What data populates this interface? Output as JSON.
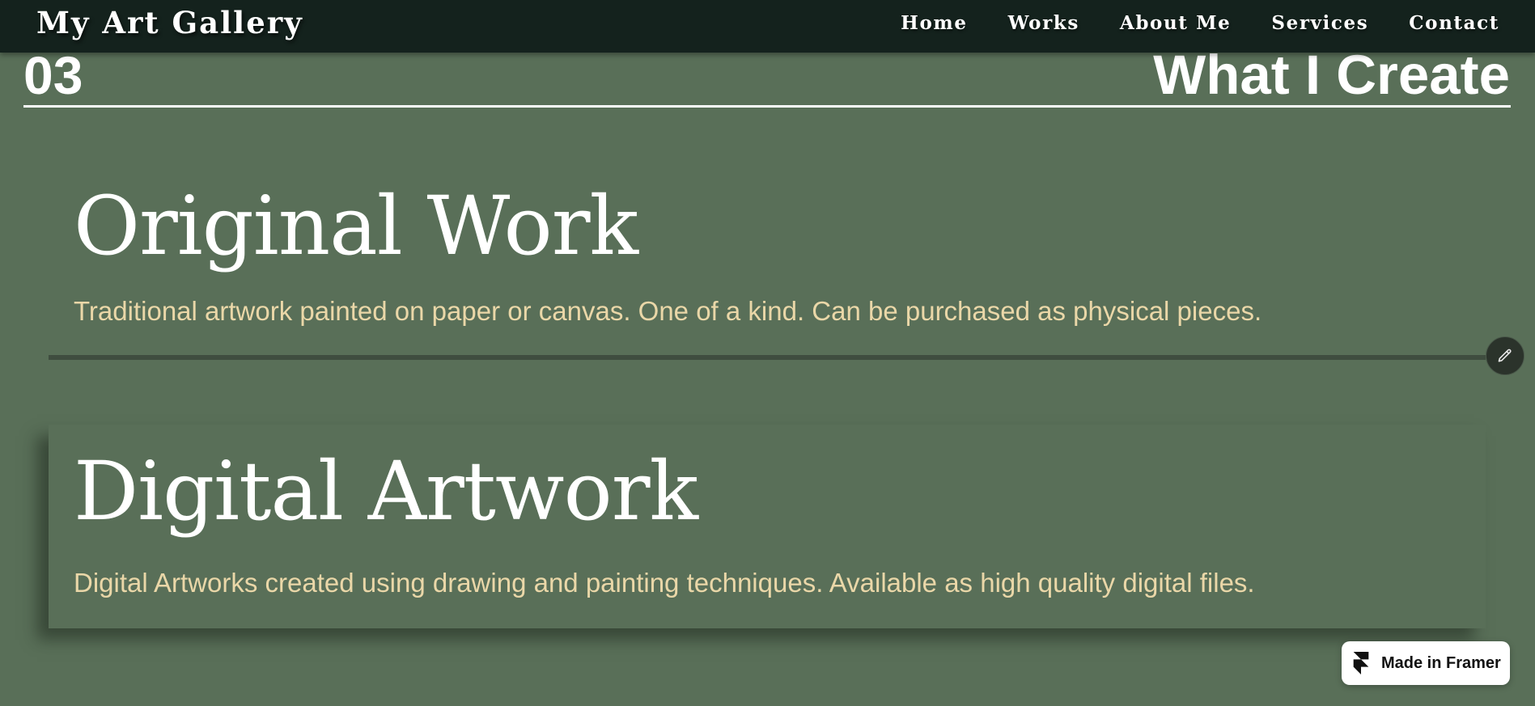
{
  "navbar": {
    "logo": "My Art Gallery",
    "links": [
      "Home",
      "Works",
      "About Me",
      "Services",
      "Contact"
    ]
  },
  "section": {
    "number": "03",
    "title": "What I Create"
  },
  "cards": [
    {
      "title": "Original Work",
      "description": "Traditional artwork painted on paper or canvas. One of a kind. Can be purchased as physical pieces."
    },
    {
      "title": "Digital Artwork",
      "description": "Digital Artworks created using drawing and painting techniques. Available as high quality digital files."
    }
  ],
  "badge": {
    "label": "Made in Framer"
  },
  "icons": {
    "edit": "pencil-icon",
    "framer": "framer-logo-icon"
  },
  "colors": {
    "background": "#596f58",
    "navbar": "#14221d",
    "heading": "#ffffff",
    "description": "#ead7a8",
    "divider": "#3f4d3f"
  }
}
